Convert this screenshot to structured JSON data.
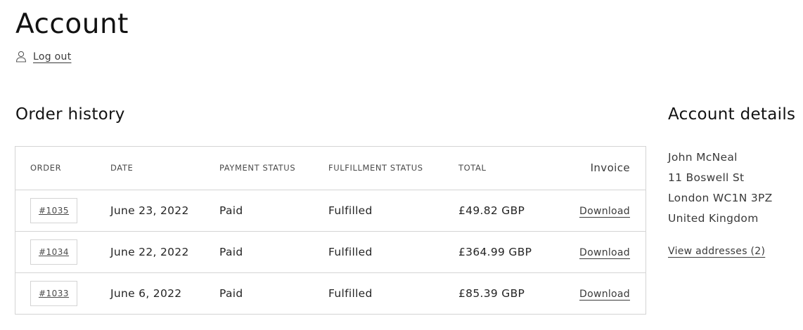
{
  "header": {
    "title": "Account",
    "logout_label": "Log out"
  },
  "orders": {
    "title": "Order history",
    "columns": [
      "ORDER",
      "DATE",
      "PAYMENT STATUS",
      "FULFILLMENT STATUS",
      "TOTAL",
      "Invoice"
    ],
    "rows": [
      {
        "order": "#1035",
        "date": "June 23, 2022",
        "payment": "Paid",
        "fulfillment": "Fulfilled",
        "total": "£49.82 GBP",
        "invoice": "Download"
      },
      {
        "order": "#1034",
        "date": "June 22, 2022",
        "payment": "Paid",
        "fulfillment": "Fulfilled",
        "total": "£364.99 GBP",
        "invoice": "Download"
      },
      {
        "order": "#1033",
        "date": "June 6, 2022",
        "payment": "Paid",
        "fulfillment": "Fulfilled",
        "total": "£85.39 GBP",
        "invoice": "Download"
      }
    ]
  },
  "details": {
    "title": "Account details",
    "address_lines": [
      "John McNeal",
      "11 Boswell St",
      "London WC1N 3PZ",
      "United Kingdom"
    ],
    "view_addresses_label": "View addresses (2)"
  },
  "icons": {
    "account": "user-icon"
  },
  "colors": {
    "text": "#121212",
    "border": "#d4d4d4"
  }
}
